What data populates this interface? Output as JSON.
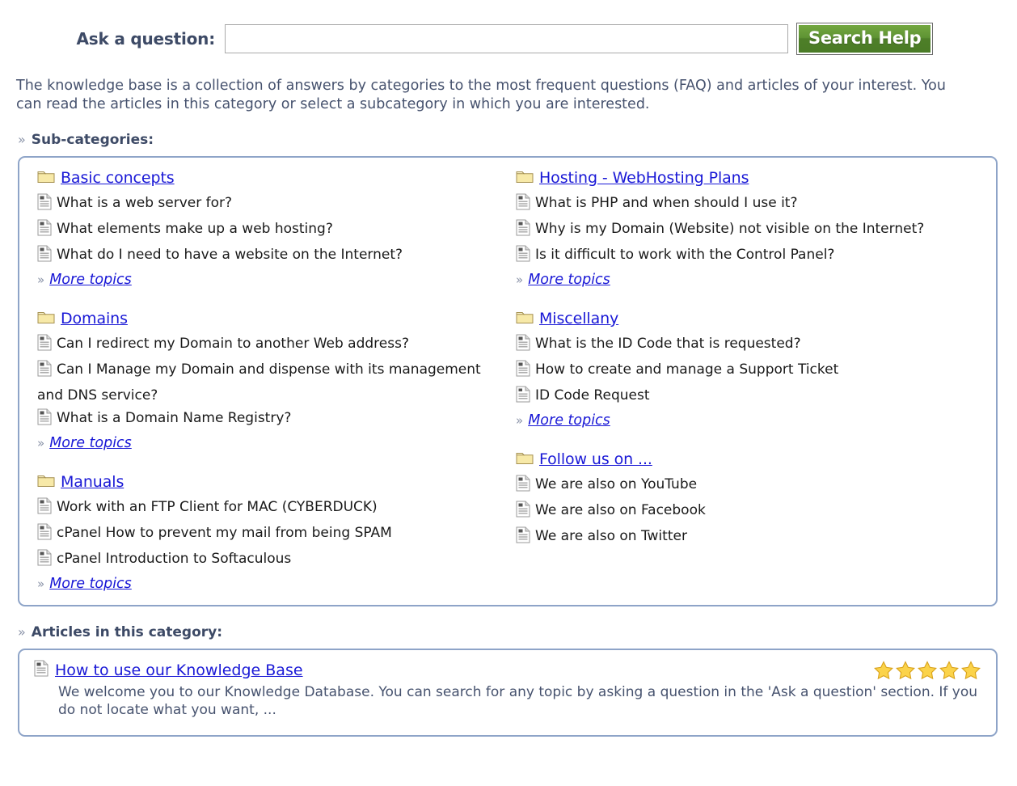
{
  "search": {
    "label": "Ask a question:",
    "input_value": "",
    "input_placeholder": "",
    "button_label": "Search Help",
    "button_color": "#5f9434"
  },
  "intro": {
    "text": "The knowledge base is a collection of answers by categories to the most frequent questions (FAQ) and articles of your interest. You can read the articles in this category or select a subcategory in which you are interested."
  },
  "headings": {
    "subcategories": "Sub-categories:",
    "articles": "Articles in this category:",
    "chevron": "»"
  },
  "link_color": "#1918d6",
  "more_topics_label": "More topics",
  "subcategories": {
    "left": [
      {
        "title": "Basic concepts",
        "topics": [
          "What is a web server for?",
          "What elements make up a web hosting?",
          "What do I need to have a website on the Internet?"
        ],
        "more": "More topics"
      },
      {
        "title": "Domains",
        "topics": [
          "Can I redirect my Domain to another Web address?",
          "Can I Manage my Domain and dispense with its management and DNS service?",
          "What is a Domain Name Registry?"
        ],
        "more": "More topics"
      },
      {
        "title": "Manuals",
        "topics": [
          "Work with an FTP Client for MAC (CYBERDUCK)",
          "cPanel How to prevent my mail from being SPAM",
          "cPanel Introduction to Softaculous"
        ],
        "more": "More topics"
      }
    ],
    "right": [
      {
        "title": "Hosting - WebHosting Plans",
        "topics": [
          "What is PHP and when should I use it?",
          "Why is my Domain (Website) not visible on the Internet?",
          "Is it difficult to work with the Control Panel?"
        ],
        "more": "More topics"
      },
      {
        "title": "Miscellany",
        "topics": [
          "What is the ID Code that is requested?",
          "How to create and manage a Support Ticket",
          "ID Code Request"
        ],
        "more": "More topics"
      },
      {
        "title": "Follow us on ...",
        "topics": [
          "We are also on YouTube",
          "We are also on Facebook",
          "We are also on Twitter"
        ],
        "more": null
      }
    ]
  },
  "articles": [
    {
      "title": "How to use our Knowledge Base",
      "description": "We welcome you to our Knowledge Database. You can search for any topic by asking a question in the 'Ask a question' section. If you do not locate what you want, ...",
      "rating": 5,
      "rating_max": 5,
      "star_color": "#f4c430"
    }
  ]
}
